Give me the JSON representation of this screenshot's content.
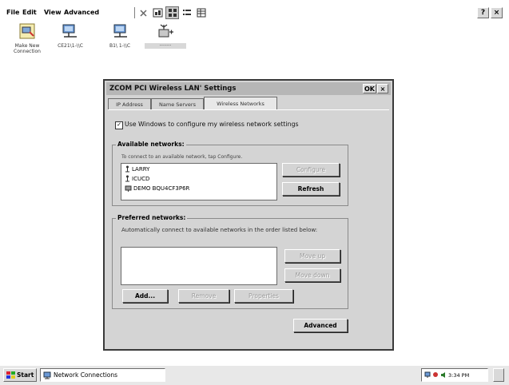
{
  "menubar": {
    "items": [
      "File",
      "Edit",
      "View",
      "Advanced"
    ],
    "toolbar_icons": [
      "delete-icon",
      "properties-icon",
      "large-icons-icon",
      "details-icon",
      "list-icon"
    ],
    "help_label": "?",
    "close_label": "×"
  },
  "desktop_icons": [
    {
      "label": "Make New Connection",
      "icon": "new-connection-icon"
    },
    {
      "label": "CE21\\1-\\\\C",
      "icon": "network-adapter-icon"
    },
    {
      "label": "B1\\ 1-\\\\C",
      "icon": "network-adapter-icon"
    },
    {
      "label": "········",
      "icon": "wireless-adapter-icon"
    }
  ],
  "dialog": {
    "title": "ZCOM PCI Wireless LAN' Settings",
    "ok_label": "OK",
    "close_label": "×",
    "tabs": [
      "IP Address",
      "Name Servers",
      "Wireless Networks"
    ],
    "active_tab": 2,
    "use_windows_checkbox": {
      "checked": true,
      "check_mark": "✓",
      "label": "Use Windows to configure my wireless network settings"
    },
    "available": {
      "title": "Available networks:",
      "hint": "To connect to an available network, tap Configure.",
      "networks": [
        {
          "name": "LARRY",
          "icon": "access-point-icon"
        },
        {
          "name": "ICUCD",
          "icon": "access-point-icon"
        },
        {
          "name": "DEMO BQU4CF3P6R",
          "icon": "computer-network-icon"
        }
      ],
      "configure_label": "Configure",
      "refresh_label": "Refresh"
    },
    "preferred": {
      "title": "Preferred networks:",
      "hint": "Automatically connect to available networks in the order listed below:",
      "move_up_label": "Move up",
      "move_down_label": "Move down",
      "add_label": "Add...",
      "remove_label": "Remove",
      "properties_label": "Properties"
    },
    "advanced_label": "Advanced"
  },
  "taskbar": {
    "start_label": "Start",
    "task_label": "Network Connections",
    "tray_time": "3:34 PM"
  }
}
